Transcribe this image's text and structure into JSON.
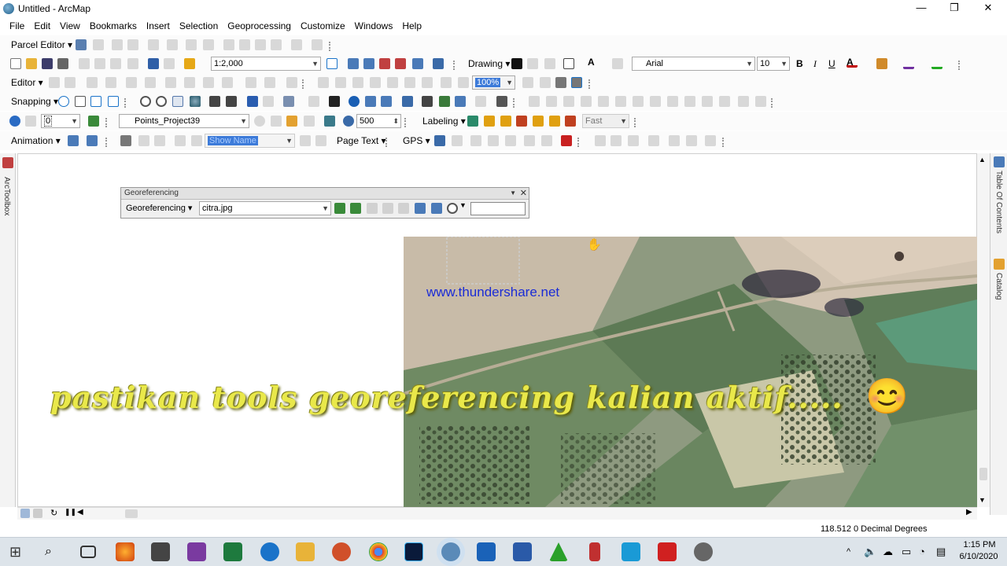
{
  "window": {
    "title": "Untitled - ArcMap",
    "minimize_glyph": "—",
    "restore_glyph": "❐",
    "close_glyph": "✕"
  },
  "menu": [
    "File",
    "Edit",
    "View",
    "Bookmarks",
    "Insert",
    "Selection",
    "Geoprocessing",
    "Customize",
    "Windows",
    "Help"
  ],
  "toolbars": {
    "parcel_editor": "Parcel Editor ▾",
    "scale": "1:2,000",
    "drawing": "Drawing ▾",
    "font_name": "Arial",
    "font_size": "10",
    "bold": "B",
    "italic": "I",
    "underline": "U",
    "editor": "Editor ▾",
    "percent_value": "100%",
    "snapping": "Snapping ▾",
    "layer": "Points_Project39",
    "layer_value": "0",
    "reference_scale": "500",
    "labeling": "Labeling ▾",
    "quality": "Fast",
    "animation": "Animation ▾",
    "show_name": "Show Name",
    "page_text": "Page Text ▾",
    "gps": "GPS ▾"
  },
  "side_tabs": {
    "left": "ArcToolbox",
    "right_toc": "Table Of Contents",
    "right_catalog": "Catalog"
  },
  "georeferencing": {
    "window_title": "Georeferencing",
    "menu_label": "Georeferencing ▾",
    "layer": "citra.jpg",
    "input_value": ""
  },
  "map": {
    "watermark": "www.thundershare.net",
    "caption": "pastikan tools georeferencing kalian aktif.....",
    "emoji": "😊"
  },
  "status": {
    "coordinates": "118.512  0 Decimal Degrees"
  },
  "taskbar": {
    "time": "1:15 PM",
    "date": "6/10/2020"
  },
  "colors": {
    "accent": "#1a73c9",
    "caption": "#e9e84a",
    "watermark": "#1a2bd6"
  }
}
